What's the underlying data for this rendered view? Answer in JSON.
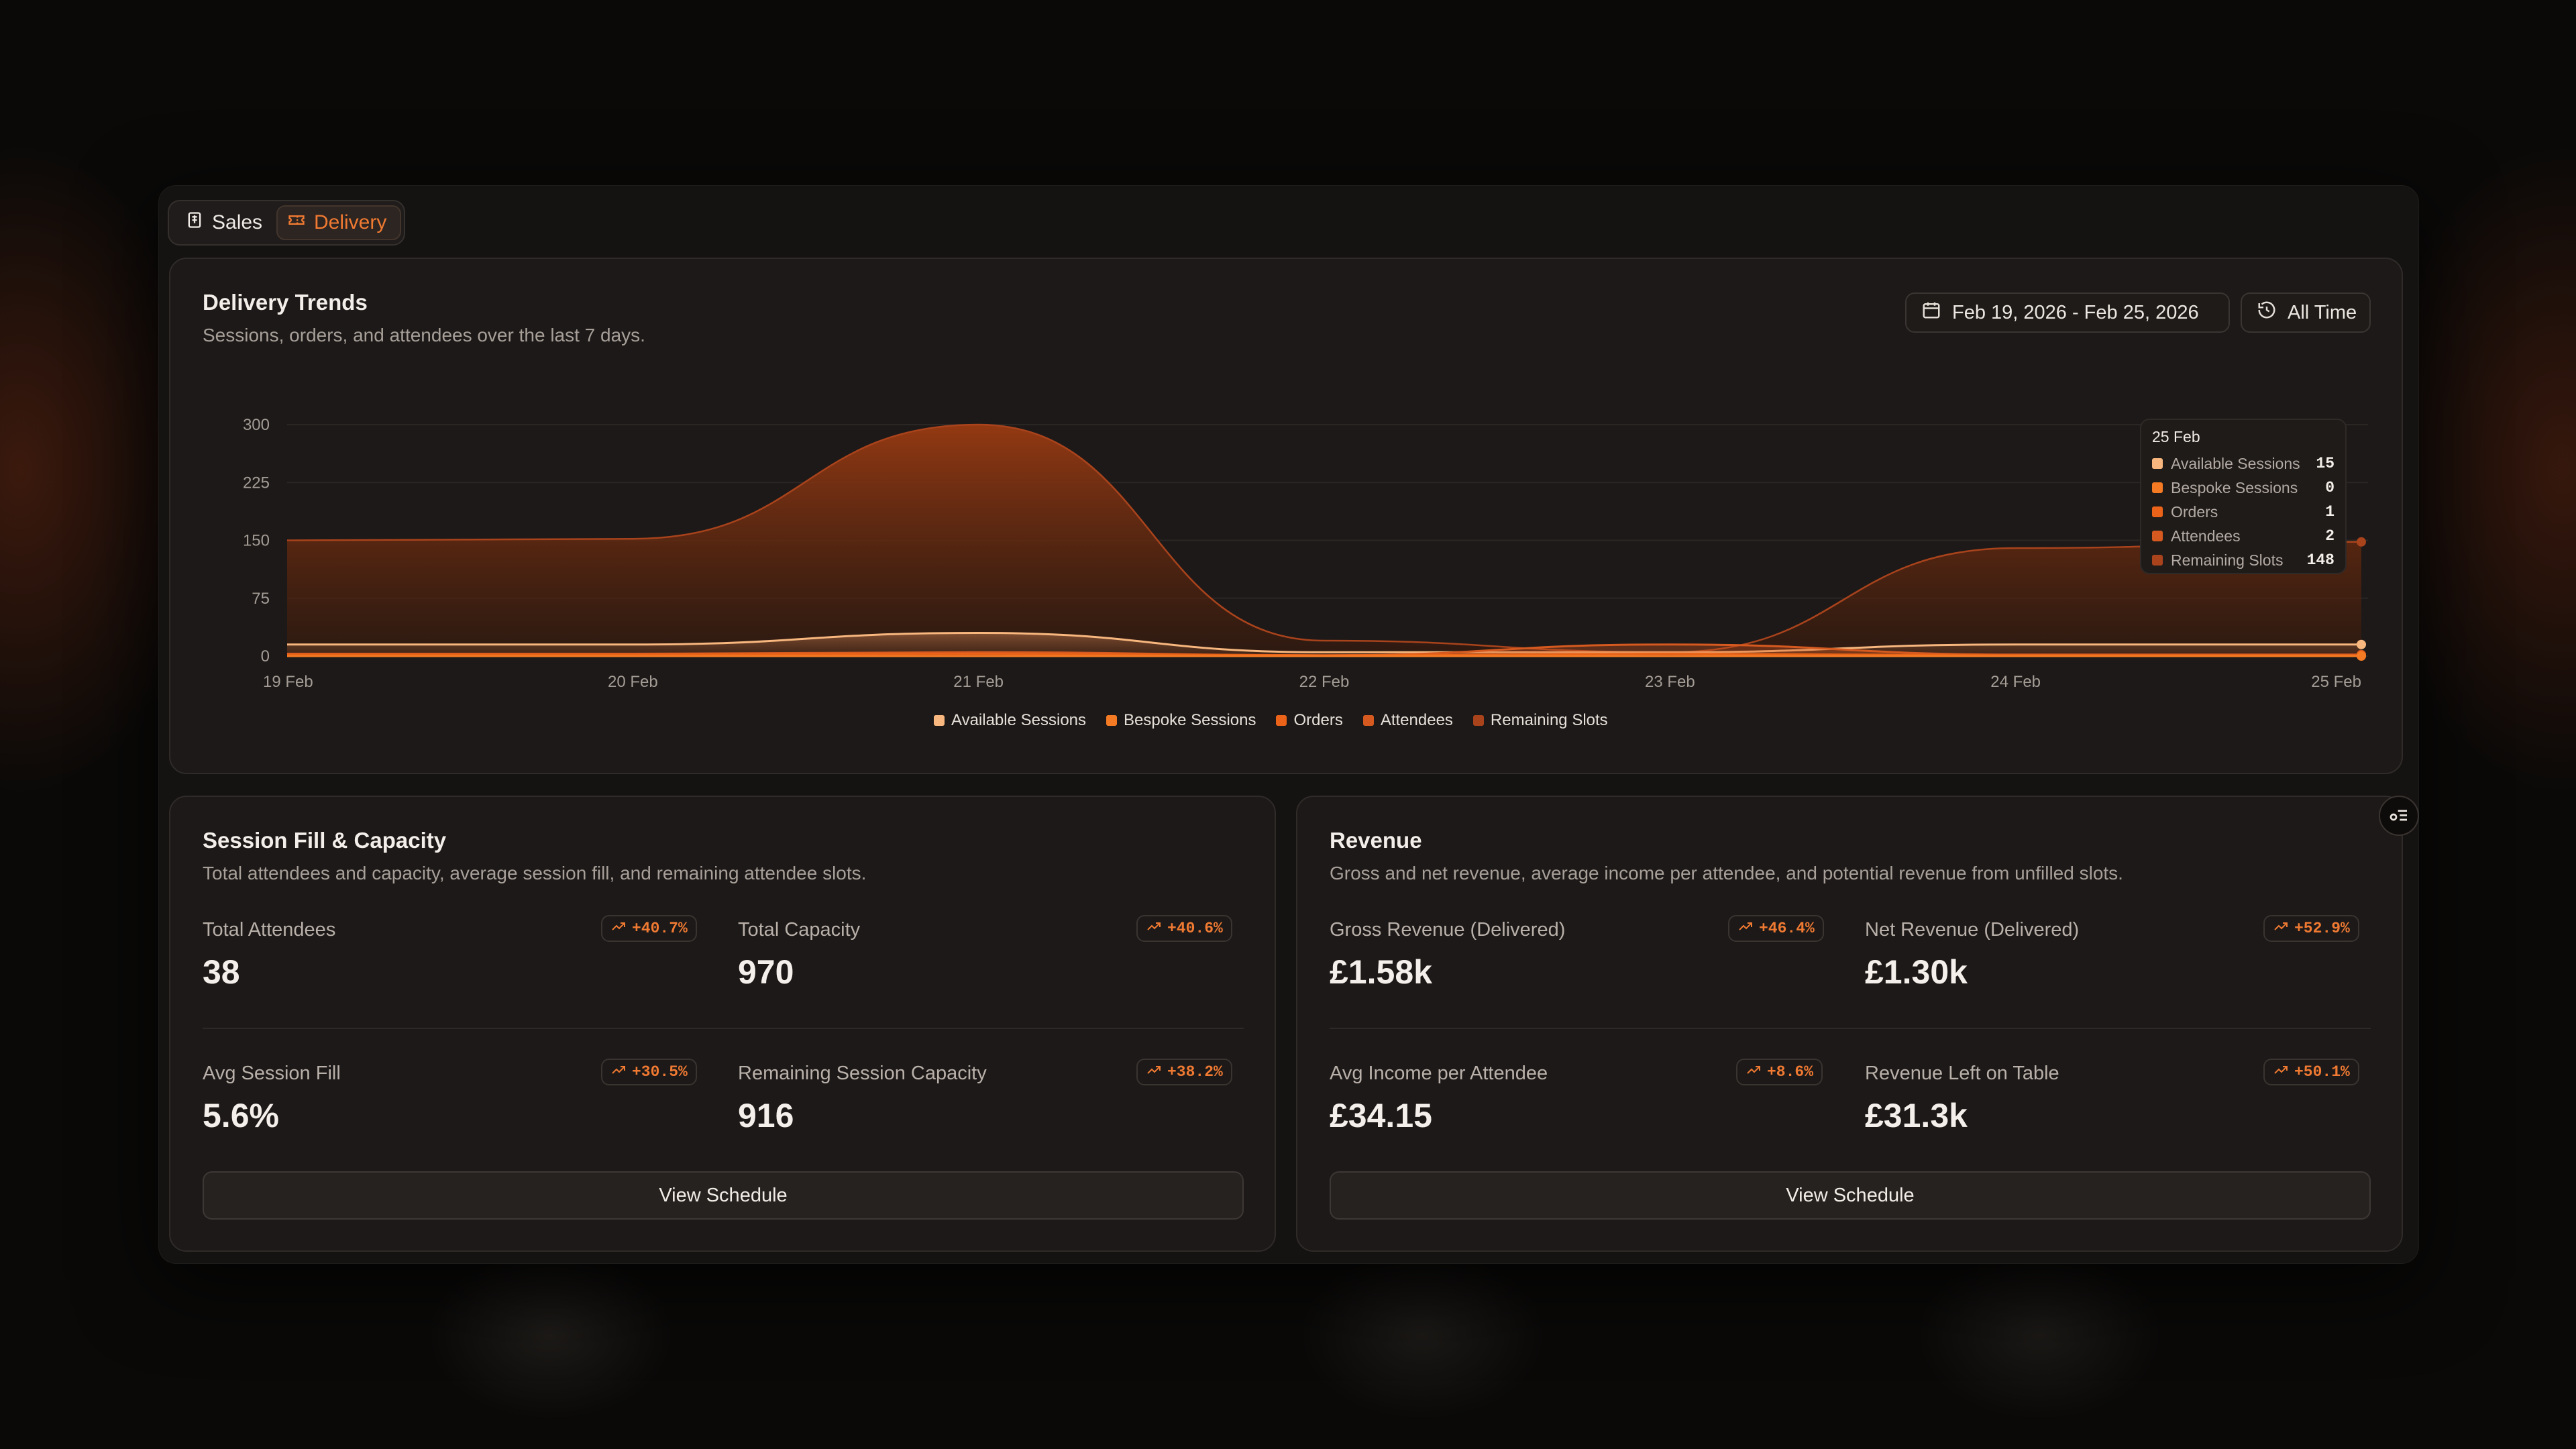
{
  "tabs": [
    {
      "label": "Sales",
      "icon": "receipt-icon"
    },
    {
      "label": "Delivery",
      "icon": "ticket-icon",
      "active": true
    }
  ],
  "trends": {
    "title": "Delivery Trends",
    "subtitle": "Sessions, orders, and attendees over the last 7 days.",
    "date_range": "Feb 19, 2026 - Feb 25, 2026",
    "all_time": "All Time"
  },
  "chart_data": {
    "type": "area",
    "x": [
      "19 Feb",
      "20 Feb",
      "21 Feb",
      "22 Feb",
      "23 Feb",
      "24 Feb",
      "25 Feb"
    ],
    "ylim": [
      0,
      300
    ],
    "yticks": [
      300,
      225,
      150,
      75,
      0
    ],
    "grid": true,
    "legend_position": "bottom",
    "series": [
      {
        "name": "Available Sessions",
        "color": "#f8b77e",
        "values": [
          15,
          15,
          30,
          5,
          5,
          15,
          15
        ]
      },
      {
        "name": "Bespoke Sessions",
        "color": "#f47a24",
        "values": [
          0,
          0,
          0,
          0,
          0,
          0,
          0
        ]
      },
      {
        "name": "Orders",
        "color": "#ea6318",
        "values": [
          2,
          2,
          3,
          1,
          3,
          1,
          1
        ]
      },
      {
        "name": "Attendees",
        "color": "#d65a20",
        "values": [
          3,
          3,
          5,
          1,
          15,
          2,
          2
        ]
      },
      {
        "name": "Remaining Slots",
        "color": "#a9431c",
        "values": [
          150,
          152,
          300,
          20,
          5,
          140,
          148
        ]
      }
    ],
    "tooltip": {
      "label": "25 Feb",
      "rows": [
        {
          "name": "Available Sessions",
          "value": "15",
          "color": "#f8b77e"
        },
        {
          "name": "Bespoke Sessions",
          "value": "0",
          "color": "#f47a24"
        },
        {
          "name": "Orders",
          "value": "1",
          "color": "#ea6318"
        },
        {
          "name": "Attendees",
          "value": "2",
          "color": "#d65a20"
        },
        {
          "name": "Remaining Slots",
          "value": "148",
          "color": "#a9431c"
        }
      ]
    }
  },
  "session": {
    "title": "Session Fill & Capacity",
    "subtitle": "Total attendees and capacity, average session fill, and remaining attendee slots.",
    "metrics": [
      {
        "label": "Total Attendees",
        "value": "38",
        "change": "+40.7%"
      },
      {
        "label": "Total Capacity",
        "value": "970",
        "change": "+40.6%"
      },
      {
        "label": "Avg Session Fill",
        "value": "5.6%",
        "change": "+30.5%"
      },
      {
        "label": "Remaining Session Capacity",
        "value": "916",
        "change": "+38.2%"
      }
    ],
    "button": "View Schedule"
  },
  "revenue": {
    "title": "Revenue",
    "subtitle": "Gross and net revenue, average income per attendee, and potential revenue from unfilled slots.",
    "metrics": [
      {
        "label": "Gross Revenue (Delivered)",
        "value": "£1.58k",
        "change": "+46.4%"
      },
      {
        "label": "Net Revenue (Delivered)",
        "value": "£1.30k",
        "change": "+52.9%"
      },
      {
        "label": "Avg Income per Attendee",
        "value": "£34.15",
        "change": "+8.6%"
      },
      {
        "label": "Revenue Left on Table",
        "value": "£31.3k",
        "change": "+50.1%"
      }
    ],
    "button": "View Schedule"
  },
  "accent_color": "#f07a32"
}
